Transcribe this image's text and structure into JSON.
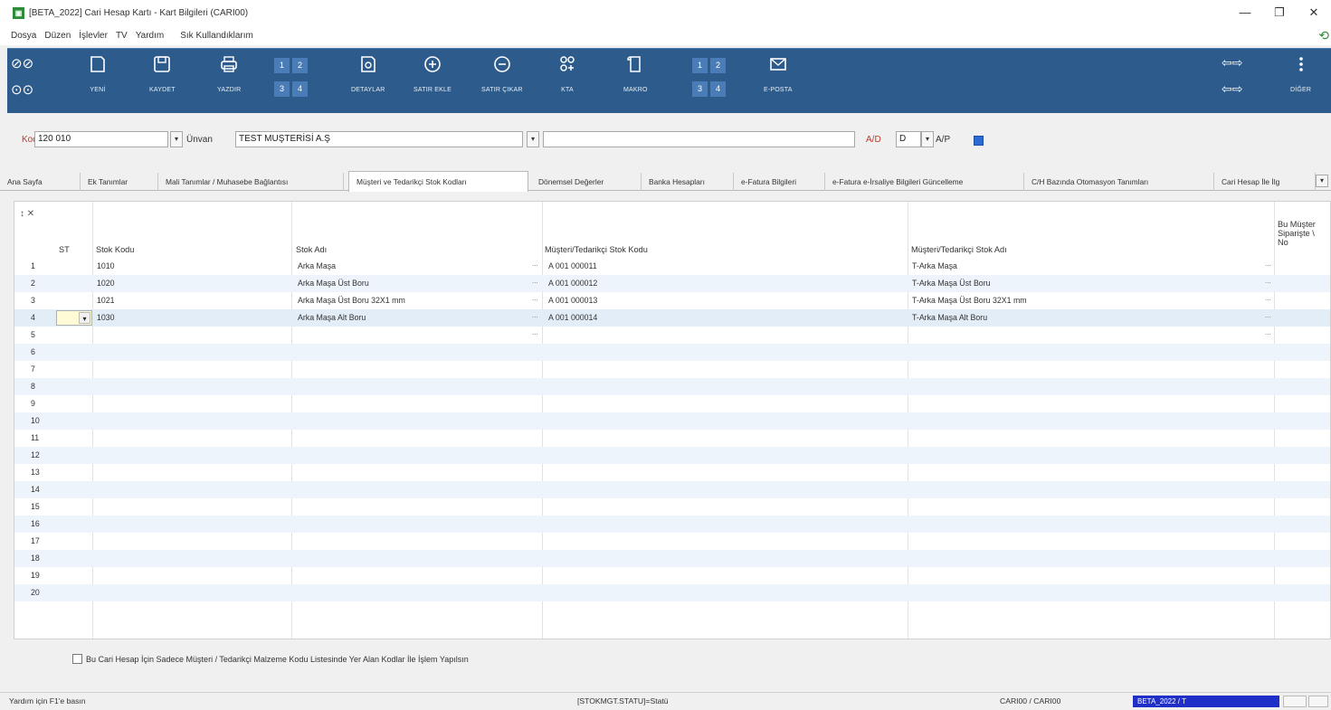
{
  "window": {
    "title": "[BETA_2022] Cari Hesap Kartı - Kart Bilgileri (CARI00)",
    "minimize": "—",
    "maximize": "❐",
    "close": "✕"
  },
  "menu": [
    "Dosya",
    "Düzen",
    "İşlevler",
    "TV",
    "Yardım",
    "Sık Kullandıklarım"
  ],
  "toolbar": {
    "new": "YENİ",
    "save": "KAYDET",
    "print": "YAZDIR",
    "details": "DETAYLAR",
    "add_row": "SATIR EKLE",
    "remove_row": "SATIR ÇIKAR",
    "kta": "KTA",
    "macro": "MAKRO",
    "email": "E-POSTA",
    "other": "DİĞER",
    "numgrid": [
      "1",
      "2",
      "3",
      "4"
    ]
  },
  "form": {
    "kod_label": "Kod",
    "kod_value": "120 010",
    "unvan_label": "Ünvan",
    "unvan_value": "TEST MUŞTERİSİ A.Ş",
    "ad_label": "A/D",
    "ad_value": "D",
    "ap_label": "A/P",
    "ap_checked": true
  },
  "tabs": [
    "Ana Sayfa",
    "Ek Tanımlar",
    "Mali Tanımlar / Muhasebe Bağlantısı",
    "Müşteri ve Tedarikçi Stok Kodları",
    "Dönemsel Değerler",
    "Banka Hesapları",
    "e-Fatura Bilgileri",
    "e-Fatura e-İrsaliye Bilgileri Güncelleme",
    "C/H Bazında Otomasyon Tanımları",
    "Cari Hesap İle İlg"
  ],
  "active_tab_index": 3,
  "grid": {
    "corner": "↕ ✕",
    "headers": {
      "st": "ST",
      "stok_kodu": "Stok Kodu",
      "stok_adi": "Stok Adı",
      "mt_stok_kodu": "Müşteri/Tedarikçi Stok Kodu",
      "mt_stok_adi": "Müşteri/Tedarikçi Stok Adı",
      "last": "Bu Müşter Siparişte \\ No"
    },
    "rows": [
      {
        "n": "1",
        "kod": "1010",
        "ad": "Arka Maşa",
        "mkod": "A 001 000011",
        "mad": "T-Arka Maşa"
      },
      {
        "n": "2",
        "kod": "1020",
        "ad": "Arka Maşa Üst Boru",
        "mkod": "A 001 000012",
        "mad": "T-Arka Maşa Üst Boru"
      },
      {
        "n": "3",
        "kod": "1021",
        "ad": "Arka Maşa Üst Boru 32X1 mm",
        "mkod": "A 001 000013",
        "mad": "T-Arka Maşa Üst Boru 32X1 mm"
      },
      {
        "n": "4",
        "kod": "1030",
        "ad": "Arka Maşa Alt Boru",
        "mkod": "A 001 000014",
        "mad": "T-Arka Maşa Alt Boru"
      },
      {
        "n": "5",
        "kod": "",
        "ad": "",
        "mkod": "",
        "mad": ""
      },
      {
        "n": "6",
        "kod": "",
        "ad": "",
        "mkod": "",
        "mad": ""
      },
      {
        "n": "7",
        "kod": "",
        "ad": "",
        "mkod": "",
        "mad": ""
      },
      {
        "n": "8",
        "kod": "",
        "ad": "",
        "mkod": "",
        "mad": ""
      },
      {
        "n": "9",
        "kod": "",
        "ad": "",
        "mkod": "",
        "mad": ""
      },
      {
        "n": "10",
        "kod": "",
        "ad": "",
        "mkod": "",
        "mad": ""
      },
      {
        "n": "11",
        "kod": "",
        "ad": "",
        "mkod": "",
        "mad": ""
      },
      {
        "n": "12",
        "kod": "",
        "ad": "",
        "mkod": "",
        "mad": ""
      },
      {
        "n": "13",
        "kod": "",
        "ad": "",
        "mkod": "",
        "mad": ""
      },
      {
        "n": "14",
        "kod": "",
        "ad": "",
        "mkod": "",
        "mad": ""
      },
      {
        "n": "15",
        "kod": "",
        "ad": "",
        "mkod": "",
        "mad": ""
      },
      {
        "n": "16",
        "kod": "",
        "ad": "",
        "mkod": "",
        "mad": ""
      },
      {
        "n": "17",
        "kod": "",
        "ad": "",
        "mkod": "",
        "mad": ""
      },
      {
        "n": "18",
        "kod": "",
        "ad": "",
        "mkod": "",
        "mad": ""
      },
      {
        "n": "19",
        "kod": "",
        "ad": "",
        "mkod": "",
        "mad": ""
      },
      {
        "n": "20",
        "kod": "",
        "ad": "",
        "mkod": "",
        "mad": ""
      }
    ]
  },
  "bottom_checkbox": "Bu Cari Hesap İçin Sadece Müşteri / Tedarikçi Malzeme Kodu Listesinde Yer Alan Kodlar İle İşlem Yapılsın",
  "status": {
    "help": "Yardım için F1'e basın",
    "field": "[STOKMGT.STATU]=Statü",
    "form": "CARI00 / CARI00",
    "company": "BETA_2022 / T"
  },
  "colors": {
    "toolbar": "#2d5c8c",
    "accent": "#2d6bd4",
    "company_bar": "#1f2fc7"
  }
}
